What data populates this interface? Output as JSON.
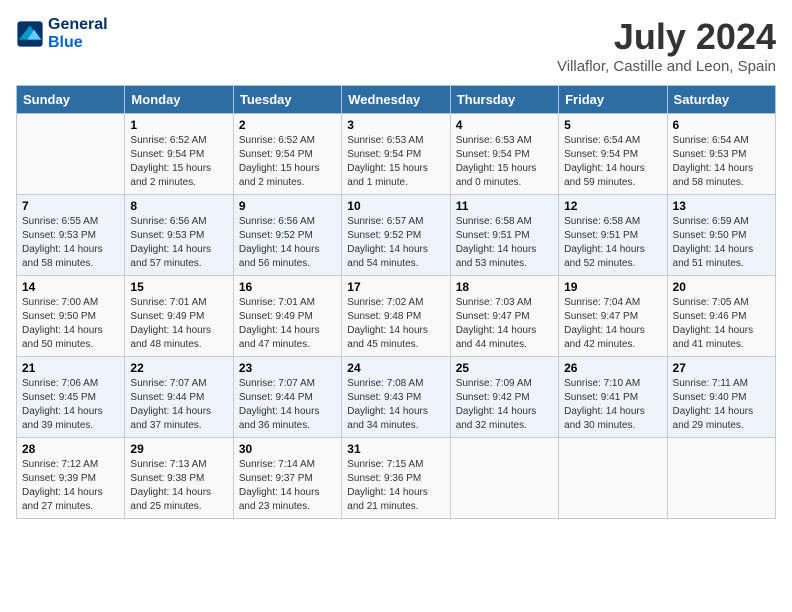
{
  "header": {
    "logo_line1": "General",
    "logo_line2": "Blue",
    "month": "July 2024",
    "location": "Villaflor, Castille and Leon, Spain"
  },
  "days_of_week": [
    "Sunday",
    "Monday",
    "Tuesday",
    "Wednesday",
    "Thursday",
    "Friday",
    "Saturday"
  ],
  "weeks": [
    [
      {
        "day": "",
        "info": ""
      },
      {
        "day": "1",
        "info": "Sunrise: 6:52 AM\nSunset: 9:54 PM\nDaylight: 15 hours\nand 2 minutes."
      },
      {
        "day": "2",
        "info": "Sunrise: 6:52 AM\nSunset: 9:54 PM\nDaylight: 15 hours\nand 2 minutes."
      },
      {
        "day": "3",
        "info": "Sunrise: 6:53 AM\nSunset: 9:54 PM\nDaylight: 15 hours\nand 1 minute."
      },
      {
        "day": "4",
        "info": "Sunrise: 6:53 AM\nSunset: 9:54 PM\nDaylight: 15 hours\nand 0 minutes."
      },
      {
        "day": "5",
        "info": "Sunrise: 6:54 AM\nSunset: 9:54 PM\nDaylight: 14 hours\nand 59 minutes."
      },
      {
        "day": "6",
        "info": "Sunrise: 6:54 AM\nSunset: 9:53 PM\nDaylight: 14 hours\nand 58 minutes."
      }
    ],
    [
      {
        "day": "7",
        "info": "Sunrise: 6:55 AM\nSunset: 9:53 PM\nDaylight: 14 hours\nand 58 minutes."
      },
      {
        "day": "8",
        "info": "Sunrise: 6:56 AM\nSunset: 9:53 PM\nDaylight: 14 hours\nand 57 minutes."
      },
      {
        "day": "9",
        "info": "Sunrise: 6:56 AM\nSunset: 9:52 PM\nDaylight: 14 hours\nand 56 minutes."
      },
      {
        "day": "10",
        "info": "Sunrise: 6:57 AM\nSunset: 9:52 PM\nDaylight: 14 hours\nand 54 minutes."
      },
      {
        "day": "11",
        "info": "Sunrise: 6:58 AM\nSunset: 9:51 PM\nDaylight: 14 hours\nand 53 minutes."
      },
      {
        "day": "12",
        "info": "Sunrise: 6:58 AM\nSunset: 9:51 PM\nDaylight: 14 hours\nand 52 minutes."
      },
      {
        "day": "13",
        "info": "Sunrise: 6:59 AM\nSunset: 9:50 PM\nDaylight: 14 hours\nand 51 minutes."
      }
    ],
    [
      {
        "day": "14",
        "info": "Sunrise: 7:00 AM\nSunset: 9:50 PM\nDaylight: 14 hours\nand 50 minutes."
      },
      {
        "day": "15",
        "info": "Sunrise: 7:01 AM\nSunset: 9:49 PM\nDaylight: 14 hours\nand 48 minutes."
      },
      {
        "day": "16",
        "info": "Sunrise: 7:01 AM\nSunset: 9:49 PM\nDaylight: 14 hours\nand 47 minutes."
      },
      {
        "day": "17",
        "info": "Sunrise: 7:02 AM\nSunset: 9:48 PM\nDaylight: 14 hours\nand 45 minutes."
      },
      {
        "day": "18",
        "info": "Sunrise: 7:03 AM\nSunset: 9:47 PM\nDaylight: 14 hours\nand 44 minutes."
      },
      {
        "day": "19",
        "info": "Sunrise: 7:04 AM\nSunset: 9:47 PM\nDaylight: 14 hours\nand 42 minutes."
      },
      {
        "day": "20",
        "info": "Sunrise: 7:05 AM\nSunset: 9:46 PM\nDaylight: 14 hours\nand 41 minutes."
      }
    ],
    [
      {
        "day": "21",
        "info": "Sunrise: 7:06 AM\nSunset: 9:45 PM\nDaylight: 14 hours\nand 39 minutes."
      },
      {
        "day": "22",
        "info": "Sunrise: 7:07 AM\nSunset: 9:44 PM\nDaylight: 14 hours\nand 37 minutes."
      },
      {
        "day": "23",
        "info": "Sunrise: 7:07 AM\nSunset: 9:44 PM\nDaylight: 14 hours\nand 36 minutes."
      },
      {
        "day": "24",
        "info": "Sunrise: 7:08 AM\nSunset: 9:43 PM\nDaylight: 14 hours\nand 34 minutes."
      },
      {
        "day": "25",
        "info": "Sunrise: 7:09 AM\nSunset: 9:42 PM\nDaylight: 14 hours\nand 32 minutes."
      },
      {
        "day": "26",
        "info": "Sunrise: 7:10 AM\nSunset: 9:41 PM\nDaylight: 14 hours\nand 30 minutes."
      },
      {
        "day": "27",
        "info": "Sunrise: 7:11 AM\nSunset: 9:40 PM\nDaylight: 14 hours\nand 29 minutes."
      }
    ],
    [
      {
        "day": "28",
        "info": "Sunrise: 7:12 AM\nSunset: 9:39 PM\nDaylight: 14 hours\nand 27 minutes."
      },
      {
        "day": "29",
        "info": "Sunrise: 7:13 AM\nSunset: 9:38 PM\nDaylight: 14 hours\nand 25 minutes."
      },
      {
        "day": "30",
        "info": "Sunrise: 7:14 AM\nSunset: 9:37 PM\nDaylight: 14 hours\nand 23 minutes."
      },
      {
        "day": "31",
        "info": "Sunrise: 7:15 AM\nSunset: 9:36 PM\nDaylight: 14 hours\nand 21 minutes."
      },
      {
        "day": "",
        "info": ""
      },
      {
        "day": "",
        "info": ""
      },
      {
        "day": "",
        "info": ""
      }
    ]
  ]
}
